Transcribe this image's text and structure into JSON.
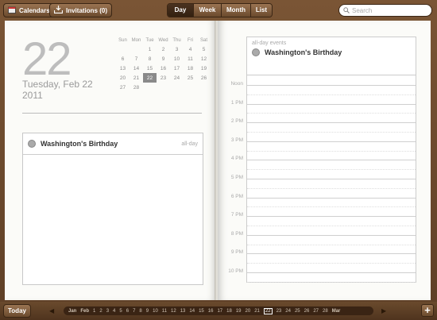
{
  "toolbar": {
    "calendars_label": "Calendars",
    "invitations_label": "Invitations (0)",
    "views": [
      "Day",
      "Week",
      "Month",
      "List"
    ],
    "active_view": "Day",
    "search_placeholder": "Search"
  },
  "day": {
    "number": "22",
    "weekday_date": "Tuesday, Feb 22",
    "year": "2011"
  },
  "mini_calendar": {
    "weekdays": [
      "Sun",
      "Mon",
      "Tue",
      "Wed",
      "Thu",
      "Fri",
      "Sat"
    ],
    "weeks": [
      [
        "",
        "",
        "1",
        "2",
        "3",
        "4",
        "5"
      ],
      [
        "6",
        "7",
        "8",
        "9",
        "10",
        "11",
        "12"
      ],
      [
        "13",
        "14",
        "15",
        "16",
        "17",
        "18",
        "19"
      ],
      [
        "20",
        "21",
        "22",
        "23",
        "24",
        "25",
        "26"
      ],
      [
        "27",
        "28",
        "",
        "",
        "",
        "",
        ""
      ]
    ],
    "selected": "22"
  },
  "left_event": {
    "title": "Washington's Birthday",
    "tag": "all-day"
  },
  "all_day_section": {
    "label": "all-day events",
    "event_title": "Washington's Birthday"
  },
  "hours": [
    "Noon",
    "1 PM",
    "2 PM",
    "3 PM",
    "4 PM",
    "5 PM",
    "6 PM",
    "7 PM",
    "8 PM",
    "9 PM",
    "10 PM"
  ],
  "bottom": {
    "today_label": "Today",
    "timeline": [
      "Jan",
      "Feb",
      "1",
      "2",
      "3",
      "4",
      "5",
      "6",
      "7",
      "8",
      "9",
      "10",
      "11",
      "12",
      "13",
      "14",
      "15",
      "16",
      "17",
      "18",
      "19",
      "20",
      "21",
      "22",
      "23",
      "24",
      "25",
      "26",
      "27",
      "28",
      "Mar"
    ],
    "current": "22",
    "add_label": "+"
  }
}
